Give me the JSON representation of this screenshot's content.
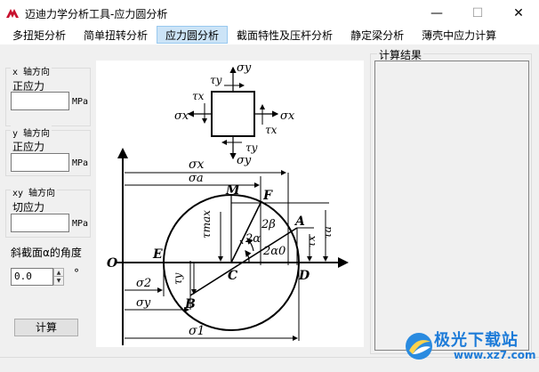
{
  "window": {
    "title": "迈迪力学分析工具-应力圆分析",
    "controls": {
      "minimize": "—",
      "maximize": "☐",
      "close": "✕"
    }
  },
  "menu": {
    "items": [
      "多扭矩分析",
      "简单扭转分析",
      "应力圆分析",
      "截面特性及压杆分析",
      "静定梁分析",
      "薄壳中应力计算"
    ],
    "active_index": 2
  },
  "left": {
    "x": {
      "heading": "x 轴方向",
      "field_label": "正应力",
      "unit": "MPa",
      "value": ""
    },
    "y": {
      "heading": "y 轴方向",
      "field_label": "正应力",
      "unit": "MPa",
      "value": ""
    },
    "xy": {
      "heading": "xy 轴方向",
      "field_label": "切应力",
      "unit": "MPa",
      "value": ""
    },
    "angle": {
      "label": "斜截面α的角度",
      "value": "0.0",
      "unit": "°"
    },
    "calc_button": "计算"
  },
  "diagram_labels": {
    "sigma_x": "σx",
    "sigma_y": "σy",
    "tau_x": "τx",
    "tau_y": "τy",
    "sigma_a": "σa",
    "tau_a": "τa",
    "tau_max": "τmax",
    "sigma_1": "σ1",
    "sigma_2": "σ2",
    "two_beta": "2β",
    "two_alpha": "2α",
    "two_alpha_0": "2α0",
    "O": "O",
    "E": "E",
    "C": "C",
    "D": "D",
    "B": "B",
    "A": "A",
    "F": "F",
    "M": "M"
  },
  "results": {
    "title": "计算结果",
    "content": ""
  },
  "watermark": {
    "text": "极光下载站",
    "url": "www.xz7.com"
  }
}
